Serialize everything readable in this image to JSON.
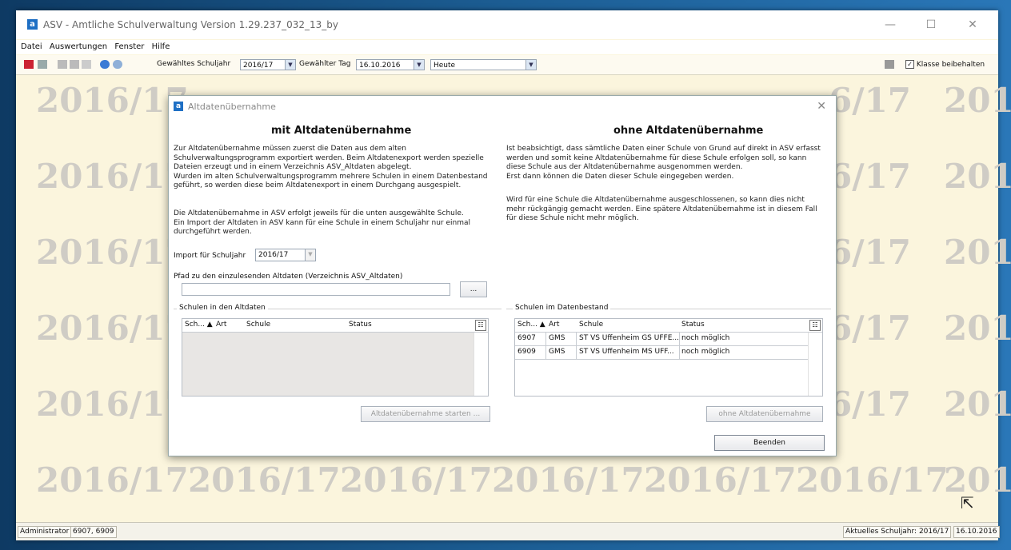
{
  "window": {
    "title": "ASV - Amtliche Schulverwaltung Version 1.29.237_032_13_by",
    "logo_letter": "a",
    "controls": {
      "minimize": "—",
      "maximize": "☐",
      "close": "✕"
    }
  },
  "menu": [
    "Datei",
    "Auswertungen",
    "Fenster",
    "Hilfe"
  ],
  "toolbar": {
    "schuljahr_label": "Gewähltes Schuljahr",
    "schuljahr_value": "2016/17",
    "tag_label": "Gewählter Tag",
    "tag_value": "16.10.2016",
    "heute_value": "Heute",
    "klasse_label": "Klasse beibehalten",
    "klasse_checked": "✓"
  },
  "watermark": "2016/17",
  "watermark_partial": "201",
  "watermark_partial2": "6/17",
  "statusbar": {
    "user": "Administrator",
    "schools": "6907, 6909",
    "right": "Aktuelles Schuljahr: 2016/17",
    "date": "16.10.2016"
  },
  "dialog": {
    "title": "Altdatenübernahme",
    "left": {
      "heading": "mit Altdatenübernahme",
      "para1": [
        "Zur Altdatenübernahme müssen zuerst die Daten aus dem alten",
        "Schulverwaltungsprogramm exportiert werden. Beim Altdatenexport werden spezielle",
        "Dateien erzeugt und in einem Verzeichnis ASV_Altdaten abgelegt.",
        "Wurden im alten Schulverwaltungsprogramm mehrere Schulen in einem Datenbestand",
        "geführt, so werden diese beim Altdatenexport in einem Durchgang ausgespielt."
      ],
      "para2": [
        "Die Altdatenübernahme in ASV erfolgt jeweils für die unten ausgewählte Schule.",
        "Ein Import der Altdaten in ASV kann für eine Schule in einem Schuljahr nur einmal",
        "durchgeführt werden."
      ],
      "import_label": "Import für Schuljahr",
      "import_value": "2016/17",
      "path_label": "Pfad zu den einzulesenden Altdaten (Verzeichnis ASV_Altdaten)",
      "browse": "...",
      "group_label": "Schulen in den Altdaten",
      "columns": [
        "Sch... ▲",
        "Art",
        "Schule",
        "Status"
      ],
      "start_button": "Altdatenübernahme starten ..."
    },
    "right": {
      "heading": "ohne Altdatenübernahme",
      "para1": [
        "Ist beabsichtigt, dass sämtliche Daten einer Schule von Grund auf direkt in ASV erfasst",
        "werden und somit keine Altdatenübernahme für diese Schule erfolgen soll, so kann",
        "diese Schule aus der Altdatenübernahme ausgenommen werden.",
        "Erst dann können die Daten dieser Schule eingegeben werden."
      ],
      "para2": [
        "Wird für eine Schule die Altdatenübernahme ausgeschlossenen, so kann dies nicht",
        "mehr rückgängig gemacht werden. Eine spätere Altdatenübernahme ist in diesem Fall",
        "für diese Schule nicht mehr möglich."
      ],
      "group_label": "Schulen im Datenbestand",
      "columns": [
        "Sch... ▲",
        "Art",
        "Schule",
        "Status"
      ],
      "rows": [
        [
          "6907",
          "GMS",
          "ST VS Uffenheim GS UFFE...",
          "noch möglich"
        ],
        [
          "6909",
          "GMS",
          "ST VS Uffenheim MS UFF...",
          "noch möglich"
        ]
      ],
      "ohne_button": "ohne Altdatenübernahme",
      "beenden_button": "Beenden"
    }
  }
}
